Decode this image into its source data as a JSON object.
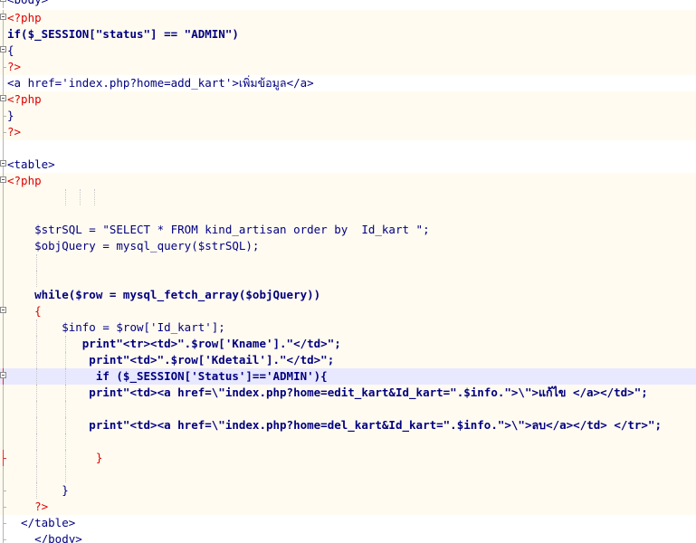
{
  "editor": {
    "lines": [
      "<body>",
      "<?php",
      "if($_SESSION[\"status\"] == \"ADMIN\")",
      "{",
      "?>",
      "<a href='index.php?home=add_kart'>เพิ่มข้อมูล</a>",
      "<?php",
      "}",
      "?>",
      "",
      "<table>",
      "<?php",
      "",
      "",
      "    $strSQL = \"SELECT * FROM kind_artisan order by  Id_kart \";",
      "    $objQuery = mysql_query($strSQL);",
      "",
      "",
      "    while($row = mysql_fetch_array($objQuery))",
      "    {",
      "        $info = $row['Id_kart'];",
      "           print\"<tr><td>\".$row['Kname'].\"</td>\";",
      "            print\"<td>\".$row['Kdetail'].\"</td>\";",
      "             if ($_SESSION['Status']=='ADMIN'){",
      "            print\"<td><a href=\\\"index.php?home=edit_kart&Id_kart=\".$info.\">\\\">แก้ไข </a></td>\";",
      "",
      "            print\"<td><a href=\\\"index.php?home=del_kart&Id_kart=\".$info.\">\\\">ลบ</a></td> </tr>\";",
      "",
      "             }",
      "",
      "        }",
      "    ?>",
      "  </table>",
      "    </body>"
    ]
  }
}
